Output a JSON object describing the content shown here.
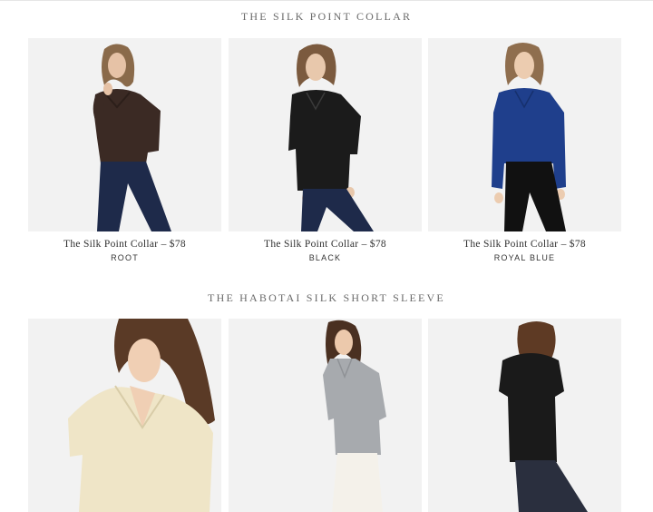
{
  "sections": [
    {
      "title": "THE SILK POINT COLLAR",
      "products": [
        {
          "name": "The Silk Point Collar – $78",
          "color": "ROOT",
          "image": "model-brown-silk-shirt",
          "swatch": "#3b2a24"
        },
        {
          "name": "The Silk Point Collar – $78",
          "color": "BLACK",
          "image": "model-black-silk-shirt",
          "swatch": "#1b1b1b"
        },
        {
          "name": "The Silk Point Collar – $78",
          "color": "ROYAL BLUE",
          "image": "model-royal-blue-silk-shirt",
          "swatch": "#1f3f8c"
        }
      ]
    },
    {
      "title": "THE HABOTAI SILK SHORT SLEEVE",
      "products": [
        {
          "name": "",
          "color": "",
          "image": "model-cream-short-sleeve",
          "swatch": "#efe5c7"
        },
        {
          "name": "",
          "color": "",
          "image": "model-grey-short-sleeve",
          "swatch": "#a7aaae"
        },
        {
          "name": "",
          "color": "",
          "image": "model-black-short-sleeve",
          "swatch": "#1a1a1a"
        }
      ]
    }
  ]
}
